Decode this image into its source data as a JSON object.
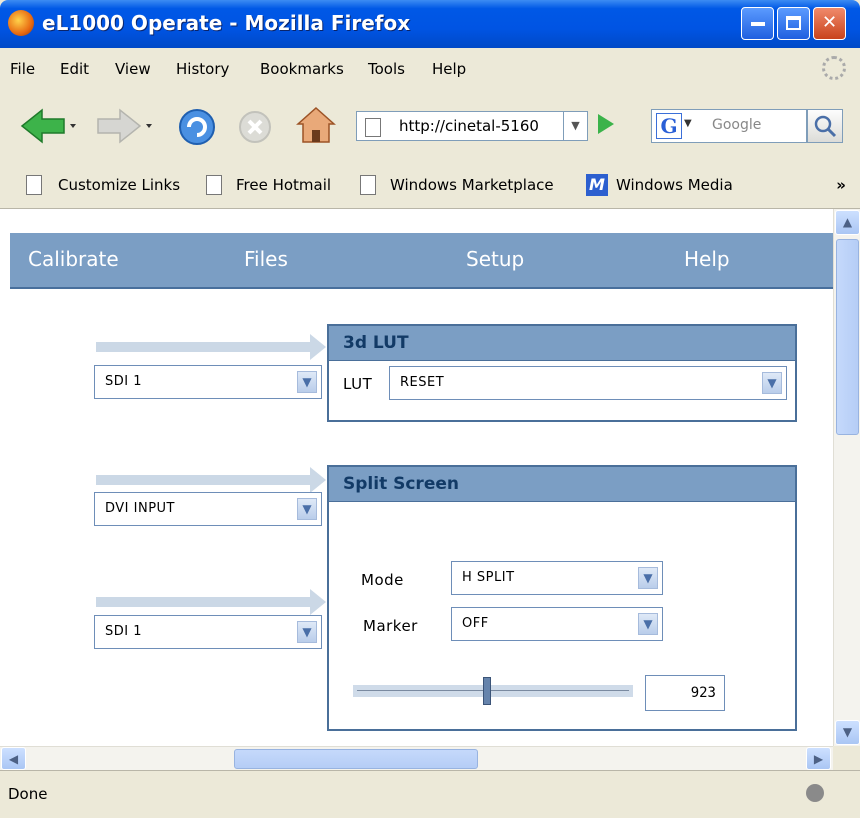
{
  "window": {
    "title": "eL1000 Operate - Mozilla Firefox"
  },
  "menu": [
    "File",
    "Edit",
    "View",
    "History",
    "Bookmarks",
    "Tools",
    "Help"
  ],
  "address": {
    "url": "http://cinetal-5160"
  },
  "search": {
    "placeholder": "Google"
  },
  "bookmarks": [
    "Customize Links",
    "Free Hotmail",
    "Windows Marketplace",
    "Windows Media"
  ],
  "bookmarks_more": "»",
  "app_nav": [
    "Calibrate",
    "Files",
    "Setup",
    "Help"
  ],
  "inputs": {
    "input1": "SDI 1",
    "input2": "DVI INPUT",
    "input3": "SDI 1"
  },
  "lut_panel": {
    "title": "3d LUT",
    "lut_label": "LUT",
    "lut_value": "RESET"
  },
  "split_panel": {
    "title": "Split Screen",
    "mode_label": "Mode",
    "mode_value": "H SPLIT",
    "marker_label": "Marker",
    "marker_value": "OFF",
    "slider_value": "923",
    "slider_position": 0.48
  },
  "status": {
    "text": "Done"
  },
  "colors": {
    "title_blue": "#0054e3",
    "nav_blue": "#7b9ec4",
    "panel_border": "#4a6f99"
  }
}
